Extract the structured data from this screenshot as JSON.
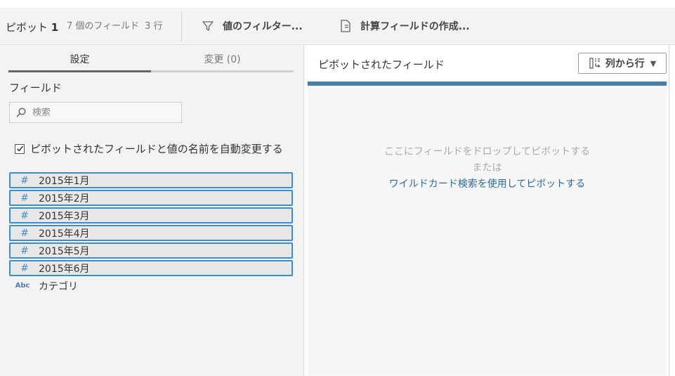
{
  "toolbar": {
    "pivot_name": "ピボット",
    "pivot_number": "1",
    "field_count": "7 個のフィールド",
    "row_count": "3 行",
    "filter_label": "値のフィルター...",
    "calc_label": "計算フィールドの作成..."
  },
  "left_panel": {
    "tabs": [
      {
        "label": "設定",
        "active": true
      },
      {
        "label": "変更 (0)",
        "active": false
      }
    ],
    "section_label": "フィールド",
    "search_placeholder": "検索",
    "auto_rename_label": "ピボットされたフィールドと値の名前を自動変更する",
    "auto_rename_checked": true,
    "fields": [
      {
        "type_icon": "#",
        "name": "2015年1月"
      },
      {
        "type_icon": "#",
        "name": "2015年2月"
      },
      {
        "type_icon": "#",
        "name": "2015年3月"
      },
      {
        "type_icon": "#",
        "name": "2015年4月"
      },
      {
        "type_icon": "#",
        "name": "2015年5月"
      },
      {
        "type_icon": "#",
        "name": "2015年6月"
      },
      {
        "type_icon": "Abc",
        "name": "カテゴリ"
      }
    ]
  },
  "right_panel": {
    "title": "ピボットされたフィールド",
    "pivot_mode_label": "列から行",
    "drop_hint_line1": "ここにフィールドをドロップしてピボットする",
    "drop_hint_line2": "または",
    "wildcard_link": "ワイルドカード検索を使用してピボットする"
  },
  "colors": {
    "accent_blue": "#3c8dcc",
    "drop_bar": "#4a7ea4",
    "link": "#2f6a9e",
    "panel_bg": "#f3f3f3"
  }
}
